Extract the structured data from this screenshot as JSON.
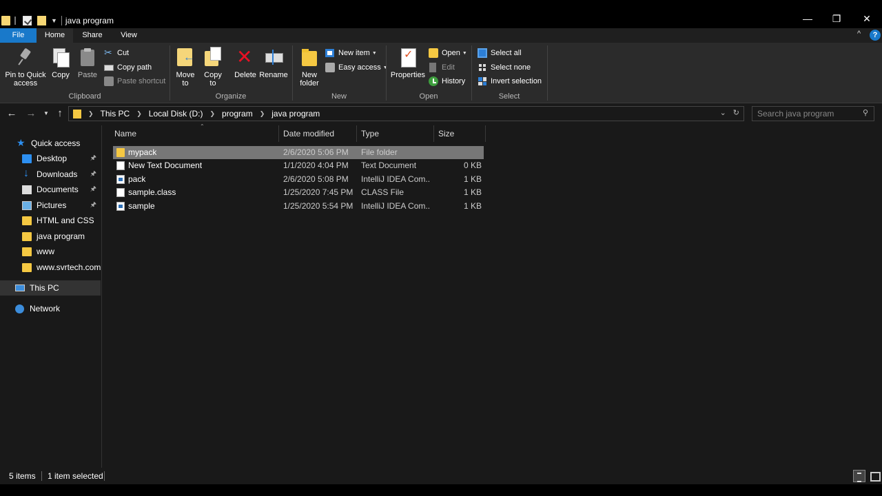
{
  "window": {
    "title": "java program",
    "controls": {
      "minimize": "—",
      "restore": "❐",
      "close": "✕"
    }
  },
  "ribbon_tabs": {
    "file": "File",
    "home": "Home",
    "share": "Share",
    "view": "View",
    "collapse": "^",
    "help": "?"
  },
  "ribbon": {
    "clipboard": {
      "label": "Clipboard",
      "pin": "Pin to Quick access",
      "copy": "Copy",
      "paste": "Paste",
      "cut": "Cut",
      "copy_path": "Copy path",
      "paste_shortcut": "Paste shortcut"
    },
    "organize": {
      "label": "Organize",
      "move_to": "Move to",
      "copy_to": "Copy to",
      "delete": "Delete",
      "rename": "Rename"
    },
    "new": {
      "label": "New",
      "new_folder": "New folder",
      "new_item": "New item",
      "easy_access": "Easy access"
    },
    "open": {
      "label": "Open",
      "properties": "Properties",
      "open": "Open",
      "edit": "Edit",
      "history": "History"
    },
    "select": {
      "label": "Select",
      "select_all": "Select all",
      "select_none": "Select none",
      "invert_selection": "Invert selection"
    }
  },
  "address": {
    "breadcrumbs": [
      "This PC",
      "Local Disk (D:)",
      "program",
      "java program"
    ]
  },
  "search": {
    "placeholder": "Search java program"
  },
  "nav_pane": {
    "quick_access": "Quick access",
    "items": [
      {
        "label": "Desktop",
        "icon": "desktop-icon",
        "pinned": true
      },
      {
        "label": "Downloads",
        "icon": "download-icon",
        "pinned": true
      },
      {
        "label": "Documents",
        "icon": "documents-icon",
        "pinned": true
      },
      {
        "label": "Pictures",
        "icon": "pictures-icon",
        "pinned": true
      },
      {
        "label": "HTML and CSS",
        "icon": "folder-icon",
        "pinned": false
      },
      {
        "label": "java program",
        "icon": "folder-icon",
        "pinned": false
      },
      {
        "label": "www",
        "icon": "folder-icon",
        "pinned": false
      },
      {
        "label": "www.svrtech.com",
        "icon": "folder-icon",
        "pinned": false
      }
    ],
    "this_pc": "This PC",
    "network": "Network"
  },
  "file_list": {
    "columns": {
      "name": "Name",
      "date": "Date modified",
      "type": "Type",
      "size": "Size"
    },
    "rows": [
      {
        "name": "mypack",
        "date": "2/6/2020 5:06 PM",
        "type": "File folder",
        "size": "",
        "icon": "folder-icon",
        "selected": true
      },
      {
        "name": "New Text Document",
        "date": "1/1/2020 4:04 PM",
        "type": "Text Document",
        "size": "0 KB",
        "icon": "text-file-icon",
        "selected": false
      },
      {
        "name": "pack",
        "date": "2/6/2020 5:08 PM",
        "type": "IntelliJ IDEA Com...",
        "size": "1 KB",
        "icon": "java-file-icon",
        "selected": false
      },
      {
        "name": "sample.class",
        "date": "1/25/2020 7:45 PM",
        "type": "CLASS File",
        "size": "1 KB",
        "icon": "class-file-icon",
        "selected": false
      },
      {
        "name": "sample",
        "date": "1/25/2020 5:54 PM",
        "type": "IntelliJ IDEA Com...",
        "size": "1 KB",
        "icon": "java-file-icon",
        "selected": false
      }
    ]
  },
  "status": {
    "items": "5 items",
    "selected": "1 item selected"
  },
  "colors": {
    "accent": "#1979ca",
    "folder": "#f5c842",
    "selection": "#777777",
    "background": "#191919"
  }
}
